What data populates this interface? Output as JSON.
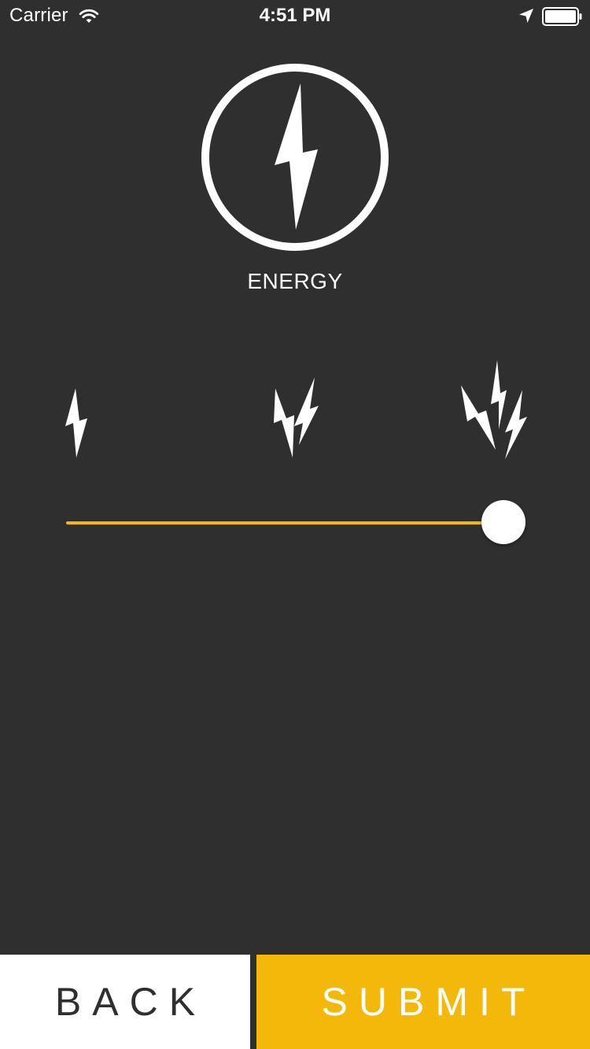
{
  "status_bar": {
    "carrier": "Carrier",
    "time": "4:51 PM",
    "icons": [
      "wifi-icon",
      "location-arrow-icon",
      "battery-icon"
    ]
  },
  "header": {
    "icon": "lightning-bolt-circle-icon",
    "title": "ENERGY"
  },
  "levels": {
    "icons": [
      "single-bolt-icon",
      "double-bolt-icon",
      "triple-bolt-icon"
    ]
  },
  "slider": {
    "value": 1.0,
    "min": 0,
    "max": 1,
    "fill_color": "#f2b90a",
    "thumb_color": "#ffffff"
  },
  "actions": {
    "back_label": "BACK",
    "submit_label": "SUBMIT",
    "submit_color": "#f4b80b"
  },
  "colors": {
    "background": "#2f2f2f",
    "accent": "#f4b80b",
    "foreground": "#ffffff"
  }
}
